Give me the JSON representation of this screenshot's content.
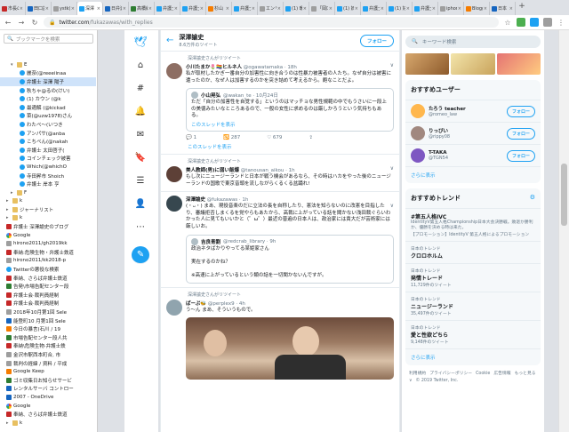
{
  "tabs": [
    {
      "label": "市長の",
      "color": "#c62828"
    },
    {
      "label": "田口詳",
      "color": "#1565c0"
    },
    {
      "label": "ystk(",
      "color": "#9e9e9e"
    },
    {
      "label": "深澤",
      "color": "#1da1f2"
    },
    {
      "label": "日弁連",
      "color": "#1565c0"
    },
    {
      "label": "高橋結",
      "color": "#2e7d32"
    },
    {
      "label": "弁護士",
      "color": "#1da1f2"
    },
    {
      "label": "弁護士",
      "color": "#1da1f2"
    },
    {
      "label": "杉山",
      "color": "#f57c00"
    },
    {
      "label": "弁護士",
      "color": "#1da1f2"
    },
    {
      "label": "エンリ",
      "color": "#9e9e9e"
    },
    {
      "label": "(1) 暖",
      "color": "#1da1f2"
    },
    {
      "label": "「岡口",
      "color": "#9e9e9e"
    },
    {
      "label": "(1) 妖",
      "color": "#1da1f2"
    },
    {
      "label": "弁護士",
      "color": "#1da1f2"
    },
    {
      "label": "(1) 好",
      "color": "#1da1f2"
    },
    {
      "label": "弁護士",
      "color": "#1da1f2"
    },
    {
      "label": "iphon",
      "color": "#9e9e9e"
    },
    {
      "label": "Blogg",
      "color": "#f57c00"
    },
    {
      "label": "日本",
      "color": "#1565c0"
    }
  ],
  "browser": {
    "url_host": "twitter.com",
    "url_path": "/fukazawas/with_replies"
  },
  "bookmarks": {
    "search_placeholder": "ブックマークを検索",
    "items": [
      {
        "label": "E",
        "type": "folder",
        "indent": 2,
        "open": true
      },
      {
        "label": "麗奈(@reeeiinaa",
        "type": "tw",
        "indent": 4
      },
      {
        "label": "弁護士 深澤 陽子",
        "type": "tw",
        "indent": 4
      },
      {
        "label": "秋ちゃ@るの(けい)",
        "type": "tw",
        "indent": 4
      },
      {
        "label": "(1) カウン (@k",
        "type": "tw",
        "indent": 4
      },
      {
        "label": "最適解 (@kickad",
        "type": "tw",
        "indent": 4
      },
      {
        "label": "菜(@uzw1978)さん",
        "type": "tw",
        "indent": 4
      },
      {
        "label": "わたべ〜(いつき",
        "type": "tw",
        "indent": 4
      },
      {
        "label": "アンパサ(@anba",
        "type": "tw",
        "indent": 4
      },
      {
        "label": "こちべん(@nakah",
        "type": "tw",
        "indent": 4
      },
      {
        "label": "弁護士 太田啓子(",
        "type": "tw",
        "indent": 4
      },
      {
        "label": "コインチェック被害",
        "type": "tw",
        "indent": 4
      },
      {
        "label": "Which(@whichO",
        "type": "tw",
        "indent": 4
      },
      {
        "label": "寺田昇市 Shoich",
        "type": "tw",
        "indent": 4
      },
      {
        "label": "弁護士 岸本 亨",
        "type": "tw",
        "indent": 4
      },
      {
        "label": "F",
        "type": "folder",
        "indent": 2
      },
      {
        "label": "k",
        "type": "folder",
        "indent": 1
      },
      {
        "label": "ジャーナリスト",
        "type": "folder",
        "indent": 1
      },
      {
        "label": "k",
        "type": "folder",
        "indent": 1
      },
      {
        "label": "弁護士 深澤諭史のブログ",
        "type": "pg",
        "indent": 1
      },
      {
        "label": "Google",
        "type": "go",
        "indent": 1
      },
      {
        "label": "hirono2011/gh2019kk",
        "type": "gy",
        "indent": 1
      },
      {
        "label": "奉納:危険生物・弁護士鉄道",
        "type": "pg",
        "indent": 1
      },
      {
        "label": "hirono2011/kk2018-p",
        "type": "gy",
        "indent": 1
      },
      {
        "label": "Twitterの悪役な検索",
        "type": "tw",
        "indent": 1
      },
      {
        "label": "奉納、さらば弁護士鉄道",
        "type": "pg",
        "indent": 1
      },
      {
        "label": "告発\\市場告配センター段",
        "type": "gr",
        "indent": 1
      },
      {
        "label": "弁護士会·裁判員経制",
        "type": "pg",
        "indent": 1
      },
      {
        "label": "弁護士会·裁判員経制",
        "type": "pg",
        "indent": 1
      },
      {
        "label": "2018年10月第1回 Sele",
        "type": "gy",
        "indent": 1
      },
      {
        "label": "能登町10 月第1回 Sele",
        "type": "bl",
        "indent": 1
      },
      {
        "label": "今日の暴言(石川 / 19",
        "type": "or",
        "indent": 1
      },
      {
        "label": "市場告配センター段人共",
        "type": "gr",
        "indent": 1
      },
      {
        "label": "奉納\\危険生物·弁護士鉄",
        "type": "pg",
        "indent": 1
      },
      {
        "label": "金沢市駅西本町合, 市",
        "type": "gy",
        "indent": 1
      },
      {
        "label": "裁判の経緯 / 資料 / 平成",
        "type": "gy",
        "indent": 1
      },
      {
        "label": "Google Keep",
        "type": "or",
        "indent": 1
      },
      {
        "label": "ゴミ収集日お知らせサービ",
        "type": "gr",
        "indent": 1
      },
      {
        "label": "レンタルサーバ コントロー",
        "type": "bl",
        "indent": 1
      },
      {
        "label": "2007 - OneDrive",
        "type": "bl",
        "indent": 1
      },
      {
        "label": "Google",
        "type": "go",
        "indent": 1
      },
      {
        "label": "奉納、さらば弁護士鉄道",
        "type": "pg",
        "indent": 1
      },
      {
        "label": "k",
        "type": "folder",
        "indent": 1
      }
    ]
  },
  "profile": {
    "name": "深澤諭史",
    "tweet_count": "8.6万件のツイート",
    "follow_label": "フォロー"
  },
  "tweets": [
    {
      "retweet_by": "深澤諭史さんがリツイート",
      "name": "小川たまか🌷🏳️‍🌈ヒルネ人",
      "handle": "@ogawatamaka · 18h",
      "avatar": "#8d6e63",
      "text": "私が取材したかぎ一番自分の加害性に向き合うのは性暴力被害者の人たち。なぜ自分は被害に遭ったのか、なぜ人は加害するのかを突き詰めて考えるから。飽なことだよ。",
      "quote": {
        "name": "小山晃弘",
        "handle": "@wakan_te · 10月24日",
        "text": "ただ「自分の加害性を自覚する」というのはマッチョな男性規範の中でもうさいに一段上の美徳みたいなところあるので、一般の女性に求めるのは厳しかろうという気持ちもある。",
        "link": "このスレッドを表示"
      },
      "actions": {
        "reply": "1",
        "retweet": "287",
        "like": "679"
      },
      "thread": "このスレッドを表示"
    },
    {
      "retweet_by": "深澤諭史さんがリツイート",
      "name": "美人教師(男)に弱い飯爆",
      "handle": "@tanousan_aikou · 1h",
      "avatar": "#5d4037",
      "text": "もし次にニュージーランドと日本が戦う機会があるなら、その時はハカをやった後のニュージーランドの国歌で東京音頭を流しながらくるくる盆踊れ!"
    },
    {
      "name": "深澤諭史",
      "handle": "@fukazawas · 1h",
      "avatar": "#37474f",
      "text": "(・ᴗ・) まあ、現役音楽のだに立法の長を自称したり、憲法を知らないのに改憲を目指したり、審議拒否しまくるを党やらもあたから、高裁に上がっている話を聞かない浅田裁ぐらいわかった人に見てもいいかと（゜ω゜）最近の普遍の日本人は、政治家には責大だが芸術家には厳しいお。",
      "quote": {
        "name": "吉良青劉",
        "handle": "@redcrab_library · 9h",
        "text": "政治ネタばかりやってる某姫家さん\n\n実在するのかね？\n\n※高速に上がっているという類の話を一切聞かないんですが。"
      }
    },
    {
      "retweet_by": "深澤諭史さんがリツイート",
      "name": "ぱーぷ🐝",
      "handle": "@perplex9 · 4h",
      "avatar": "#90a4ae",
      "text": "う〜ん まあ、そういうもので。"
    }
  ],
  "right": {
    "search_placeholder": "キーワード検索",
    "reco_title": "おすすめユーザー",
    "recos": [
      {
        "name": "たろう teacher",
        "handle": "@romeo_law",
        "avatar": "#ffb74d",
        "follow": "フォロー"
      },
      {
        "name": "りっぴい",
        "handle": "@rippy08",
        "avatar": "#a1887f",
        "follow": "フォロー"
      },
      {
        "name": "T-TAKA",
        "handle": "@TGN54",
        "avatar": "#7e57c2",
        "follow": "フォロー"
      }
    ],
    "reco_more": "さらに表示",
    "trends_title": "おすすめトレンド",
    "trends": [
      {
        "cat": "",
        "name": "#第五人格IVC",
        "desc": "IdentityV第五人格Championship日本大会決勝戦。敗退か勝利か、優勝を決める時は来た。",
        "promo": "【プロモーション】IdentityV 第五人格によるプロモーション"
      },
      {
        "cat": "日本のトレンド",
        "name": "クロロホルム",
        "desc": "",
        "promo": ""
      },
      {
        "cat": "日本のトレンド",
        "name": "発情トレード",
        "desc": "",
        "promo": "11,729件のツイート"
      },
      {
        "cat": "日本のトレンド",
        "name": "ニュージーランド",
        "desc": "",
        "promo": "35,497件のツイート"
      },
      {
        "cat": "日本のトレンド",
        "name": "愛と性欲どちら",
        "desc": "",
        "promo": "9,148件のツイート"
      }
    ],
    "trends_more": "さらに表示",
    "footer": [
      "利用規約",
      "プライバシーポリシー",
      "Cookie",
      "広告情報",
      "もっと見る ∨",
      "© 2019 Twitter, Inc."
    ]
  }
}
